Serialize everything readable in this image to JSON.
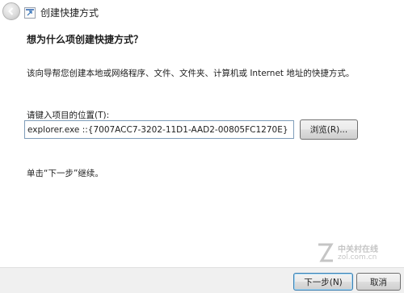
{
  "window": {
    "title": "创建快捷方式"
  },
  "main": {
    "heading": "想为什么项创建快捷方式？",
    "description": "该向导帮您创建本地或网络程序、文件、文件夹、计算机或 Internet 地址的快捷方式。",
    "location_label": "请键入项目的位置(T):",
    "location_value": "explorer.exe ::{7007ACC7-3202-11D1-AAD2-00805FC1270E}",
    "browse_label": "浏览(R)...",
    "hint": "单击“下一步”继续。"
  },
  "footer": {
    "next_label": "下一步(N)",
    "cancel_label": "取消"
  },
  "watermark": {
    "line1": "中关村在线",
    "line2": "zol.com.cn"
  }
}
